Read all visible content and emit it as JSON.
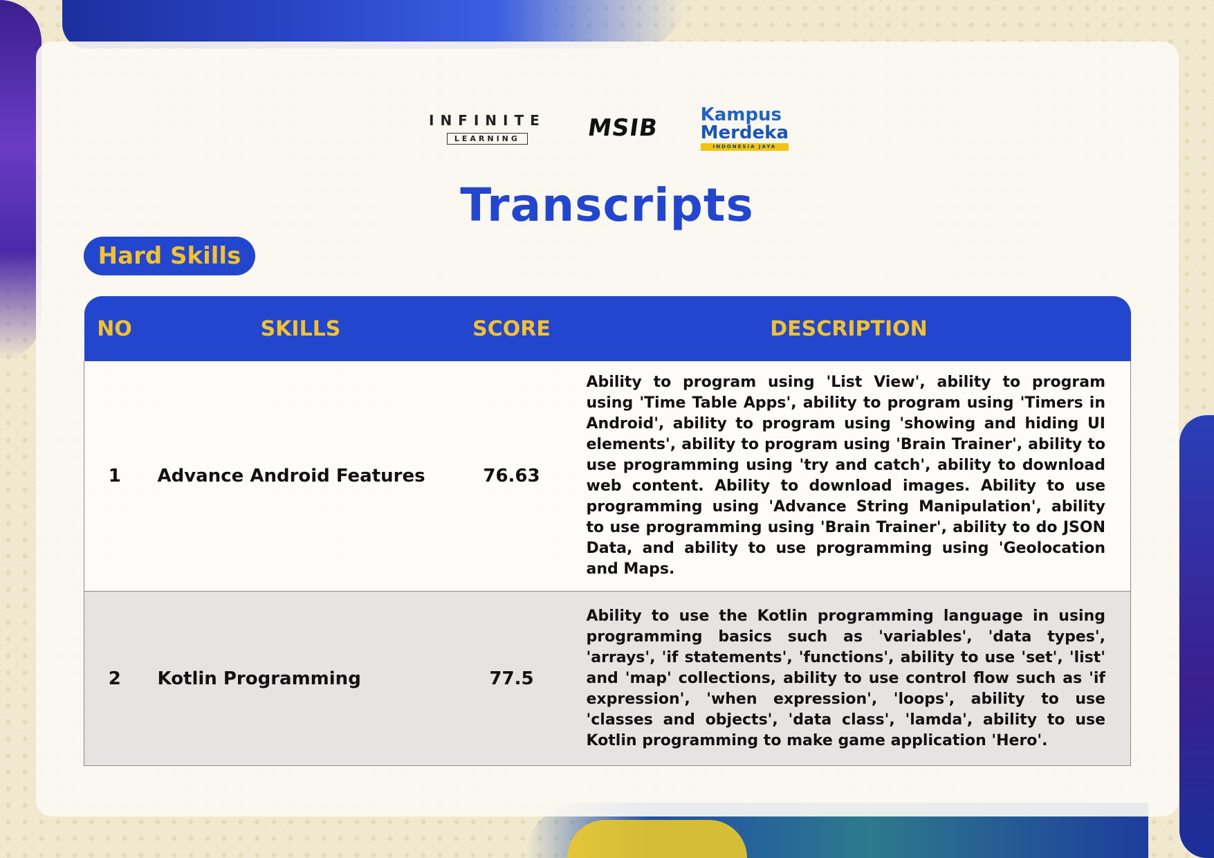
{
  "logos": {
    "infinite": {
      "main": "INFINITE",
      "sub": "LEARNING"
    },
    "msib": {
      "main": "MSIB"
    },
    "kampus_merdeka": {
      "line1": "Kampus",
      "line2": "Merdeka",
      "tag": "INDONESIA JAYA"
    }
  },
  "title": "Transcripts",
  "section": "Hard Skills",
  "table": {
    "headers": [
      "NO",
      "SKILLS",
      "SCORE",
      "DESCRIPTION"
    ],
    "rows": [
      {
        "no": "1",
        "skill": "Advance Android Features",
        "score": "76.63",
        "description": "Ability to program using 'List View', ability to program using 'Time Table Apps', ability to program using 'Timers in Android', ability to program using 'showing and hiding UI elements', ability to program using 'Brain Trainer', ability to use programming using 'try and catch', ability to download web content. Ability to download images. Ability to use programming using 'Advance String Manipulation', ability to use programming using 'Brain Trainer', ability to do JSON Data, and ability to use programming using 'Geolocation and Maps."
      },
      {
        "no": "2",
        "skill": "Kotlin Programming",
        "score": "77.5",
        "description": "Ability to use the Kotlin programming language in using programming basics such as 'variables', 'data types', 'arrays', 'if statements', 'functions', ability to use 'set', 'list' and 'map' collections, ability to use control flow such as 'if expression', 'when expression', 'loops', ability to use 'classes and objects', 'data class', 'lamda', ability to use Kotlin programming to make game application 'Hero'."
      }
    ]
  },
  "colors": {
    "primary_blue": "#2346cf",
    "accent_yellow": "#f2c12e"
  }
}
